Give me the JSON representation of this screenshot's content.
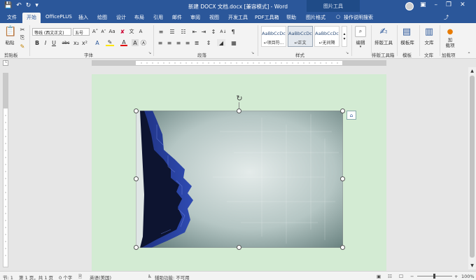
{
  "window": {
    "title": "新建 DOCX 文档.docx [兼容模式] - Word",
    "contextual_group": "图片工具"
  },
  "tabs": [
    "文件",
    "开始",
    "OfficePLUS",
    "插入",
    "绘图",
    "设计",
    "布局",
    "引用",
    "邮件",
    "审阅",
    "视图",
    "开发工具",
    "PDF工具箱",
    "帮助",
    "图片格式"
  ],
  "active_tab": "开始",
  "tell_me": "操作说明搜索",
  "ribbon": {
    "clipboard": {
      "paste_label": "粘贴",
      "group_label": "剪贴板"
    },
    "font": {
      "font_name": "等线 (西文正文)",
      "font_size": "五号",
      "group_label": "字体",
      "format_buttons": [
        "B",
        "I",
        "U",
        "abc",
        "x₂",
        "x²"
      ]
    },
    "paragraph": {
      "group_label": "段落"
    },
    "styles": {
      "group_label": "样式",
      "items": [
        {
          "sample": "AaBbCcDc",
          "name": "↵项目符..."
        },
        {
          "sample": "AaBbCcDc",
          "name": "↵正文"
        },
        {
          "sample": "AaBbCcDc",
          "name": "↵无间隔"
        }
      ]
    },
    "editing": {
      "label": "编辑"
    },
    "layout_tool": {
      "label": "排版工具",
      "group_label": "排版工具箱"
    },
    "template": {
      "label": "模板库",
      "group_label": "模板"
    },
    "docs": {
      "label": "文库",
      "group_label": "文库"
    },
    "addins": {
      "label": "加\n载项",
      "group_label": "加载项"
    }
  },
  "statusbar": {
    "page_num": "节: 1",
    "page_of": "第 1 页，共 1 页",
    "word_count": "0 个字",
    "language": "英语(美国)",
    "accessibility": "辅助功能: 不可用",
    "zoom": "100%"
  },
  "colors": {
    "brand_blue": "#2b579a",
    "page_green": "#d3ebd3",
    "image_blue": "#2c45a6"
  }
}
